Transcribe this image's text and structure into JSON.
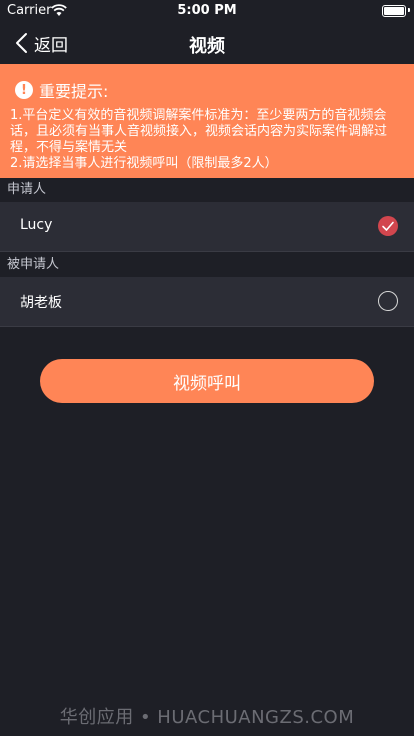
{
  "status_bar": {
    "carrier": "Carrier",
    "time": "5:00 PM"
  },
  "nav": {
    "back_label": "返回",
    "title": "视频"
  },
  "notice": {
    "icon": "!",
    "title": "重要提示:",
    "lines": [
      "1.平台定义有效的音视频调解案件标准为：至少要两方的音视频会话，且必须有当事人音视频接入，视频会话内容为实际案件调解过程，不得与案情无关",
      "2.请选择当事人进行视频呼叫（限制最多2人）"
    ]
  },
  "sections": [
    {
      "header": "申请人",
      "name": "Lucy",
      "selected": true
    },
    {
      "header": "被申请人",
      "name": "胡老板",
      "selected": false
    }
  ],
  "call_button": "视频呼叫",
  "watermark": "华创应用 • HUACHUANGZS.COM",
  "colors": {
    "accent": "#ff8556",
    "check": "#d2464e",
    "background": "#1e1f26",
    "row": "#2c2d36"
  }
}
